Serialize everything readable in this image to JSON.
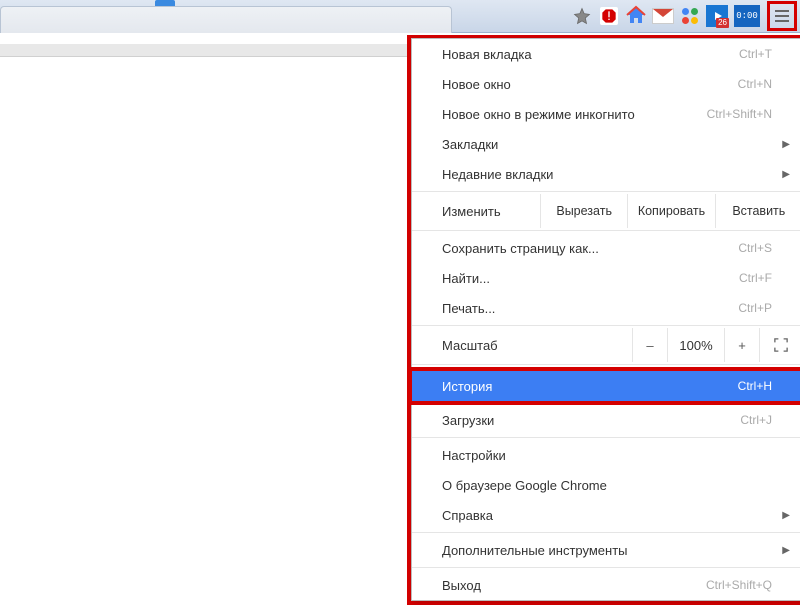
{
  "toolbar": {
    "play_badge": "26",
    "timer": "0:00"
  },
  "menu": {
    "new_tab": {
      "label": "Новая вкладка",
      "shortcut": "Ctrl+T"
    },
    "new_window": {
      "label": "Новое окно",
      "shortcut": "Ctrl+N"
    },
    "incognito": {
      "label": "Новое окно в режиме инкогнито",
      "shortcut": "Ctrl+Shift+N"
    },
    "bookmarks": {
      "label": "Закладки"
    },
    "recent_tabs": {
      "label": "Недавние вкладки"
    },
    "edit": {
      "label": "Изменить",
      "cut": "Вырезать",
      "copy": "Копировать",
      "paste": "Вставить"
    },
    "save_as": {
      "label": "Сохранить страницу как...",
      "shortcut": "Ctrl+S"
    },
    "find": {
      "label": "Найти...",
      "shortcut": "Ctrl+F"
    },
    "print": {
      "label": "Печать...",
      "shortcut": "Ctrl+P"
    },
    "zoom": {
      "label": "Масштаб",
      "minus": "–",
      "value": "100%",
      "plus": "+"
    },
    "history": {
      "label": "История",
      "shortcut": "Ctrl+H"
    },
    "downloads": {
      "label": "Загрузки",
      "shortcut": "Ctrl+J"
    },
    "settings": {
      "label": "Настройки"
    },
    "about": {
      "label": "О браузере Google Chrome"
    },
    "help": {
      "label": "Справка"
    },
    "more_tools": {
      "label": "Дополнительные инструменты"
    },
    "exit": {
      "label": "Выход",
      "shortcut": "Ctrl+Shift+Q"
    }
  }
}
